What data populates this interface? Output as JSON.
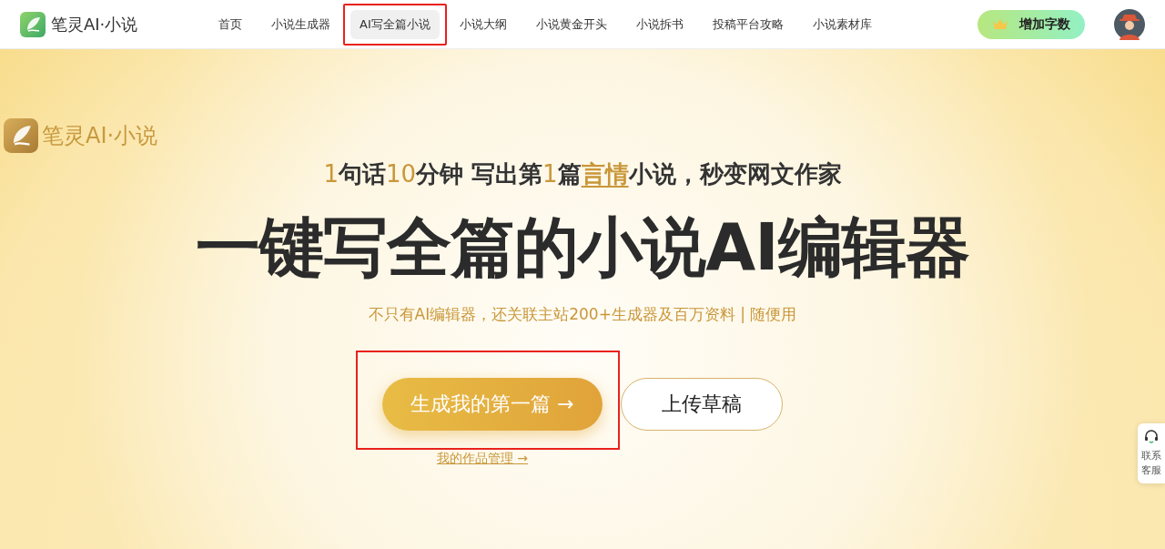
{
  "header": {
    "brand": "笔灵AI·小说",
    "nav": [
      {
        "label": "首页",
        "selected": false,
        "highlighted": false
      },
      {
        "label": "小说生成器",
        "selected": false,
        "highlighted": false
      },
      {
        "label": "AI写全篇小说",
        "selected": true,
        "highlighted": true
      },
      {
        "label": "小说大纲",
        "selected": false,
        "highlighted": false
      },
      {
        "label": "小说黄金开头",
        "selected": false,
        "highlighted": false
      },
      {
        "label": "小说拆书",
        "selected": false,
        "highlighted": false
      },
      {
        "label": "投稿平台攻略",
        "selected": false,
        "highlighted": false
      },
      {
        "label": "小说素材库",
        "selected": false,
        "highlighted": false
      }
    ],
    "upgrade_button": "增加字数"
  },
  "hero": {
    "brand": "笔灵AI·小说",
    "tagline": [
      {
        "text": "1",
        "kind": "accent"
      },
      {
        "text": "句话",
        "kind": "plain"
      },
      {
        "text": "10",
        "kind": "accent"
      },
      {
        "text": "分钟 写出第",
        "kind": "plain"
      },
      {
        "text": "1",
        "kind": "accent"
      },
      {
        "text": "篇",
        "kind": "plain"
      },
      {
        "text": "言情",
        "kind": "keyword"
      },
      {
        "text": "小说，秒变网文作家",
        "kind": "plain"
      }
    ],
    "title": "一键写全篇的小说AI编辑器",
    "subtitle": "不只有AI编辑器，还关联主站200+生成器及百万资料 | 随便用",
    "primary_button": {
      "label": "生成我的第一篇 →",
      "highlighted": true
    },
    "secondary_button": "上传草稿",
    "works_link": "我的作品管理 →"
  },
  "support": {
    "label": "联系客服"
  }
}
